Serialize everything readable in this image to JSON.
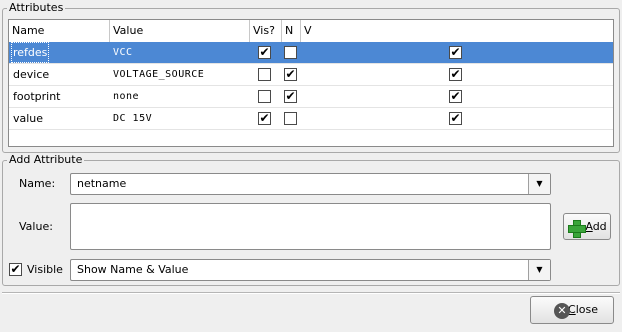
{
  "attributes_group": {
    "title": "Attributes",
    "columns": [
      "Name",
      "Value",
      "Vis?",
      "N",
      "V"
    ],
    "rows": [
      {
        "name": "refdes",
        "value": "VCC",
        "vis": "✔",
        "n": "",
        "v": "✔",
        "selected": true
      },
      {
        "name": "device",
        "value": "VOLTAGE_SOURCE",
        "vis": "",
        "n": "✔",
        "v": "✔",
        "selected": false
      },
      {
        "name": "footprint",
        "value": "none",
        "vis": "",
        "n": "✔",
        "v": "✔",
        "selected": false
      },
      {
        "name": "value",
        "value": "DC 15V",
        "vis": "✔",
        "n": "",
        "v": "✔",
        "selected": false
      }
    ]
  },
  "add_attribute": {
    "title": "Add Attribute",
    "name_label": "Name:",
    "name_value": "netname",
    "value_label": "Value:",
    "value_text": "",
    "add_button": {
      "underlined": "A",
      "rest": "dd"
    },
    "visible_checkbox": "✔",
    "visible_label": "Visible",
    "visibility_option": "Show Name & Value"
  },
  "close_button": {
    "underlined": "C",
    "rest": "lose"
  },
  "colors": {
    "selection": "#4c88d4",
    "add_icon": "#3aa53a"
  }
}
